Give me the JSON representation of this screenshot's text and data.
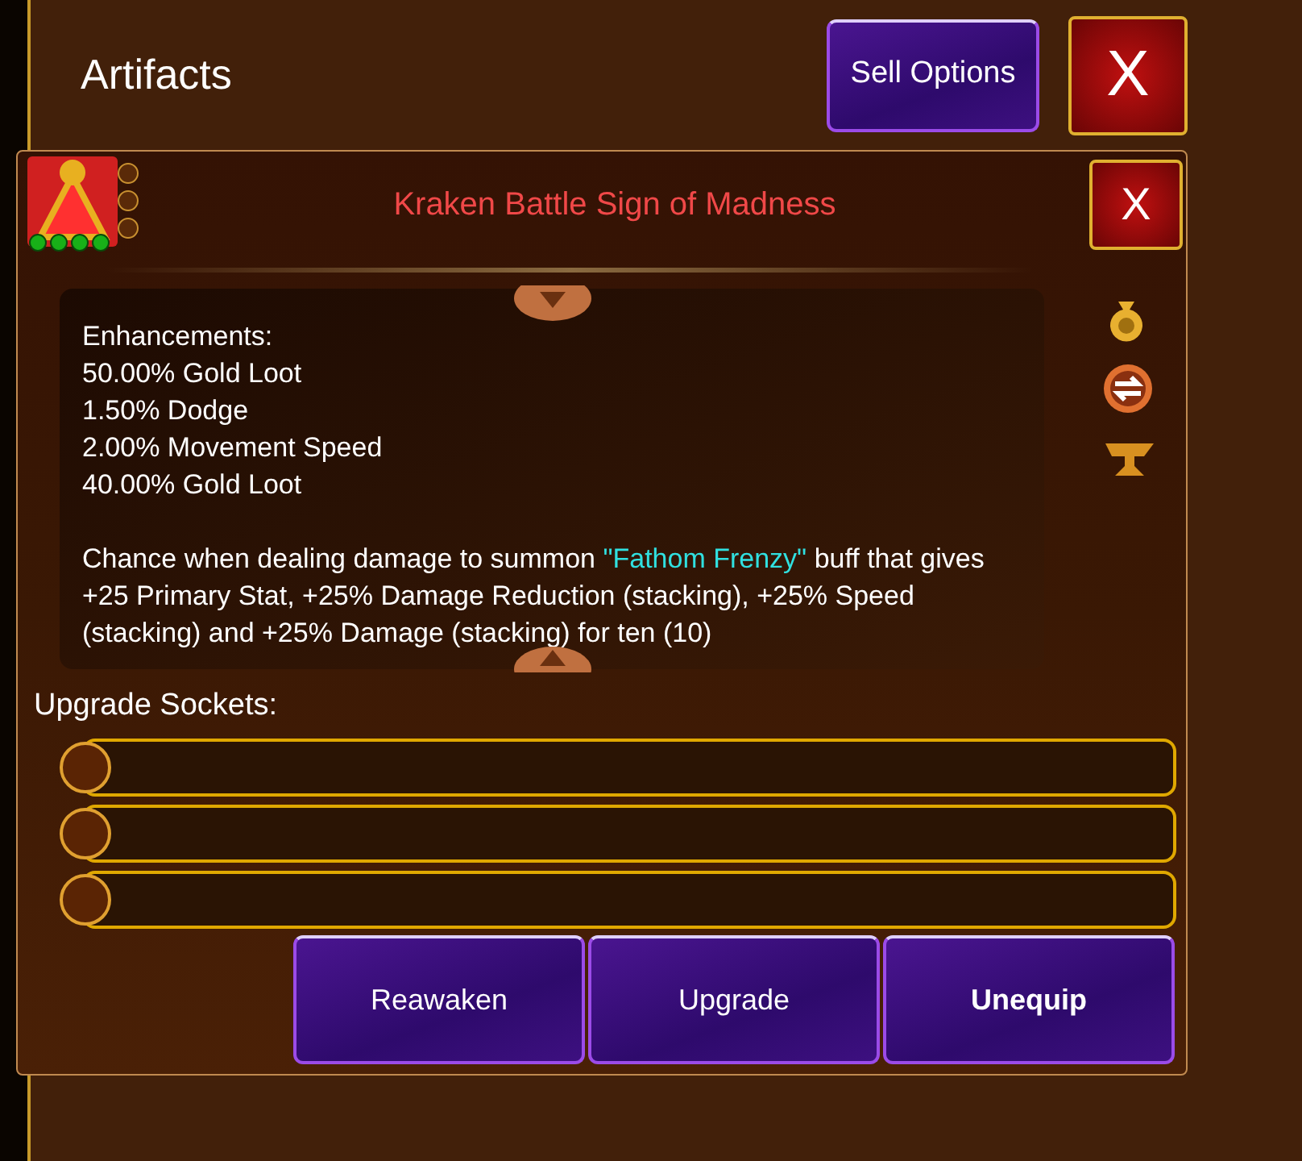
{
  "header": {
    "title": "Artifacts",
    "sell_button": "Sell Options",
    "close_button": "X"
  },
  "dialog": {
    "item_icon": {
      "stars": 4
    },
    "title": "Kraken Battle Sign of Madness",
    "close_button": "X",
    "enhancements_heading": "Enhancements:",
    "enhancements": [
      "50.00% Gold Loot",
      "1.50% Dodge",
      "2.00% Movement Speed",
      "40.00% Gold Loot"
    ],
    "description": {
      "before": "Chance when dealing damage to summon ",
      "highlight": "\"Fathom Frenzy\"",
      "after": " buff that gives +25 Primary Stat, +25% Damage Reduction (stacking), +25% Speed (stacking) and +25% Damage (stacking) for ten (10)"
    },
    "sockets_heading": "Upgrade Sockets:",
    "sockets": [
      {
        "filled": false
      },
      {
        "filled": false
      },
      {
        "filled": false
      }
    ],
    "buttons": [
      "Reawaken",
      "Upgrade",
      "Unequip"
    ]
  }
}
